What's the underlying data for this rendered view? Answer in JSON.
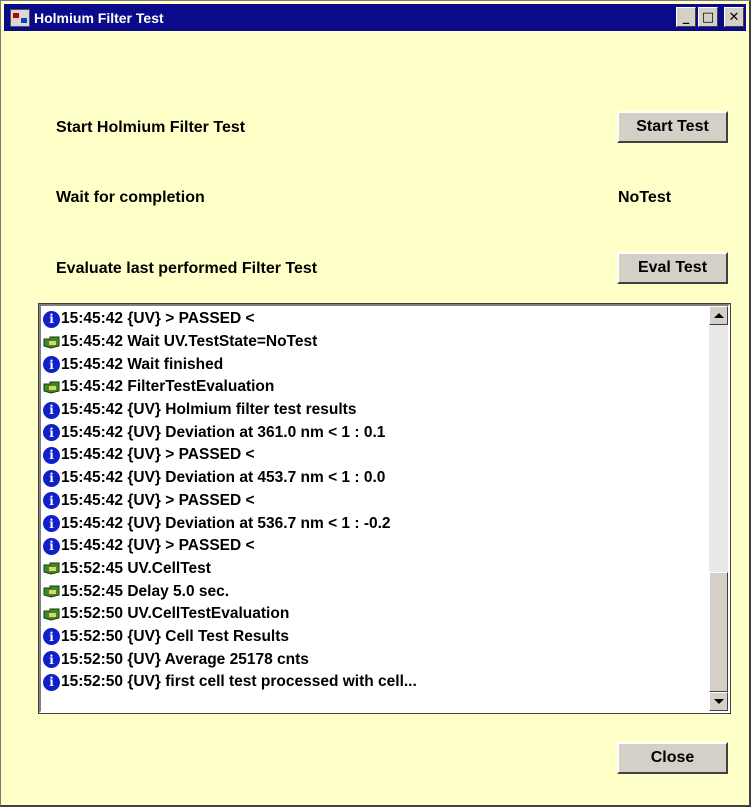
{
  "window": {
    "title": "Holmium Filter Test",
    "controls": {
      "minimize": "_",
      "maximize": "□",
      "close": "✕"
    }
  },
  "steps": {
    "start_label": "Start Holmium Filter Test",
    "start_button": "Start Test",
    "wait_label": "Wait for completion",
    "wait_status": "NoTest",
    "eval_label": "Evaluate last performed Filter Test",
    "eval_button": "Eval Test"
  },
  "log": {
    "icon_colors": {
      "info": "#1020c8",
      "command": "#3a8a2a"
    },
    "entries": [
      {
        "icon": "info-icon",
        "text": "15:45:42 {UV} > PASSED <"
      },
      {
        "icon": "command-icon",
        "text": "15:45:42 Wait  UV.TestState=NoTest"
      },
      {
        "icon": "info-icon",
        "text": "15:45:42 Wait finished"
      },
      {
        "icon": "command-icon",
        "text": "15:45:42 FilterTestEvaluation"
      },
      {
        "icon": "info-icon",
        "text": "15:45:42 {UV} Holmium filter test results"
      },
      {
        "icon": "info-icon",
        "text": "15:45:42 {UV} Deviation at 361.0 nm < 1 : 0.1"
      },
      {
        "icon": "info-icon",
        "text": "15:45:42 {UV} > PASSED <"
      },
      {
        "icon": "info-icon",
        "text": "15:45:42 {UV} Deviation at 453.7 nm < 1 : 0.0"
      },
      {
        "icon": "info-icon",
        "text": "15:45:42 {UV} > PASSED <"
      },
      {
        "icon": "info-icon",
        "text": "15:45:42 {UV} Deviation at 536.7 nm < 1 : -0.2"
      },
      {
        "icon": "info-icon",
        "text": "15:45:42 {UV} > PASSED <"
      },
      {
        "icon": "command-icon",
        "text": "15:52:45 UV.CellTest"
      },
      {
        "icon": "command-icon",
        "text": "15:52:45 Delay 5.0 sec."
      },
      {
        "icon": "command-icon",
        "text": "15:52:50 UV.CellTestEvaluation"
      },
      {
        "icon": "info-icon",
        "text": "15:52:50 {UV} Cell Test Results"
      },
      {
        "icon": "info-icon",
        "text": "15:52:50 {UV} Average 25178 cnts"
      },
      {
        "icon": "info-icon",
        "text": "15:52:50 {UV} first cell test processed with cell..."
      }
    ],
    "scroll_position": 1.0
  },
  "footer": {
    "close_button": "Close"
  }
}
